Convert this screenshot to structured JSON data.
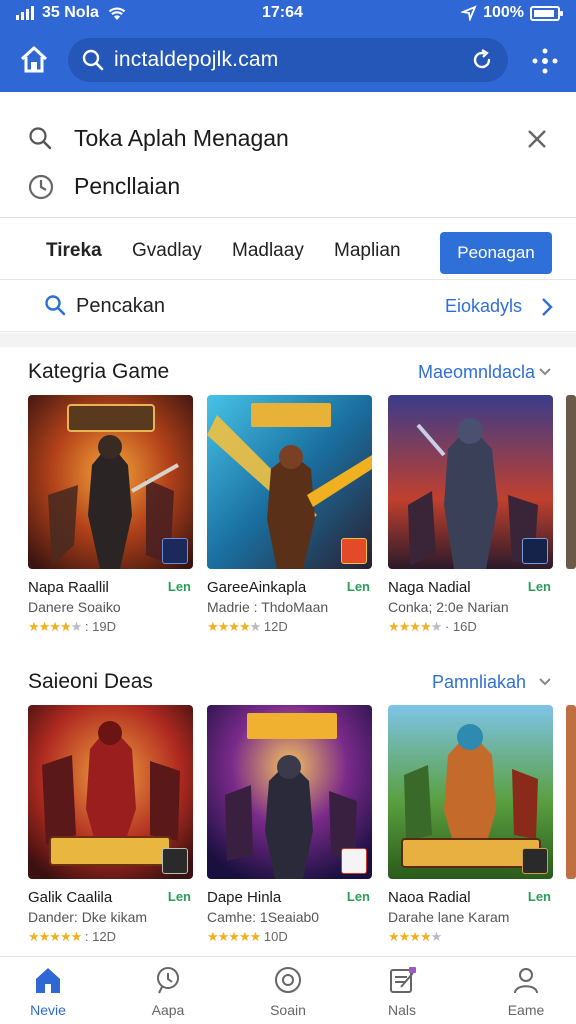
{
  "status_bar": {
    "carrier": "35 Nola",
    "time": "17:64",
    "battery": "100%"
  },
  "browser": {
    "url": "inctaldepojlk.cam"
  },
  "suggestions": [
    {
      "icon": "search-icon",
      "text": "Toka Aplah Menagan"
    },
    {
      "icon": "history-icon",
      "text": "Pencllaian"
    }
  ],
  "tabs": [
    {
      "label": "Tireka",
      "active": true
    },
    {
      "label": "Gvadlay"
    },
    {
      "label": "Madlaay"
    },
    {
      "label": "Maplian"
    }
  ],
  "tab_button": "Peonagan",
  "subsearch": {
    "text": "Pencakan",
    "link": "Eiokadyls"
  },
  "sections": [
    {
      "title": "Kategria Game",
      "link": "Maeomnldacla",
      "cards": [
        {
          "name": "Napa Raallil",
          "tag": "Len",
          "sub": "Danere Soaiko",
          "rating": "4.5",
          "count": "19",
          "suffix": "D",
          "stars": 4
        },
        {
          "name": "GareeAinkapla",
          "tag": "Len",
          "sub": "Madrie : ThdoMaan",
          "rating": "4.5",
          "count": "12",
          "suffix": "D",
          "stars": 4
        },
        {
          "name": "Naga Nadial",
          "tag": "Len",
          "sub": "Conka; 2:0e Narian",
          "rating": "4.5",
          "count": "16",
          "suffix": "D",
          "stars": 4
        }
      ]
    },
    {
      "title": "Saieoni Deas",
      "link": "Pamnliakah",
      "cards": [
        {
          "name": "Galik Caalila",
          "tag": "Len",
          "sub": "Dander: Dke kikam",
          "rating": "5",
          "count": "12",
          "suffix": "D",
          "stars": 5
        },
        {
          "name": "Dape Hinla",
          "tag": "Len",
          "sub": "Camhe: 1Seaiab0",
          "rating": "5",
          "count": "10",
          "suffix": "D",
          "stars": 5
        },
        {
          "name": "Naoa Radial",
          "tag": "Len",
          "sub": "Darahe lane Karam",
          "rating": "4",
          "count": "",
          "suffix": "",
          "stars": 4
        }
      ]
    }
  ],
  "bottom_nav": [
    {
      "label": "Nevie",
      "icon": "home-icon",
      "active": true
    },
    {
      "label": "Aapa",
      "icon": "apps-icon"
    },
    {
      "label": "Soain",
      "icon": "target-icon"
    },
    {
      "label": "Nals",
      "icon": "notes-icon"
    },
    {
      "label": "Eame",
      "icon": "profile-icon"
    }
  ],
  "colors": {
    "primary": "#2f68d4",
    "accent_link": "#2f6fd8",
    "star": "#f2b01e",
    "tag_green": "#2a9d57"
  }
}
